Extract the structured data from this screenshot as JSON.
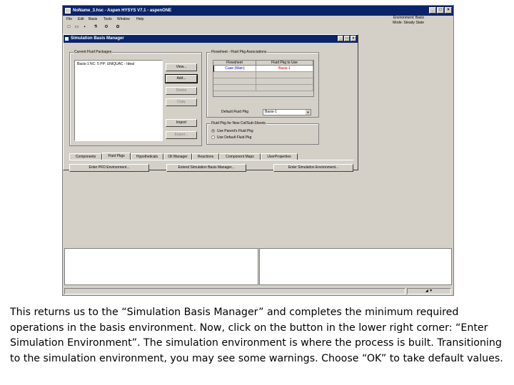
{
  "app": {
    "title": "NoName_3.hsc - Aspen HYSYS V7.1 - aspenONE",
    "window_buttons": [
      "_",
      "□",
      "×"
    ],
    "menu": [
      "File",
      "Edit",
      "Basis",
      "Tools",
      "Window",
      "Help"
    ],
    "menu_right": [
      "Environment: Basis",
      "Mode: Steady State"
    ],
    "toolbar_icons": [
      "new-icon",
      "open-icon",
      "save-icon",
      "fluid-package-icon",
      "components-icon"
    ]
  },
  "sbm": {
    "title": "Simulation Basis Manager",
    "window_buttons": [
      "_",
      "□",
      "×"
    ],
    "current_fluid_packages": {
      "group_label": "Current Fluid Packages",
      "items": [
        "Basis-1    NC: 5    PP: UNIQUAC - Ideal"
      ],
      "buttons": {
        "view": "View...",
        "add": "Add...",
        "delete": "Delete",
        "copy": "Copy",
        "import": "Import",
        "export": "Export..."
      }
    },
    "flowsheet_assoc": {
      "group_label": "Flowsheet - Fluid Pkg Associations",
      "columns": [
        "Flowsheet",
        "Fluid Pkg to Use"
      ],
      "rows": [
        [
          "Case (Main)",
          "Basis-1"
        ],
        [
          "",
          ""
        ],
        [
          "",
          ""
        ],
        [
          "",
          ""
        ]
      ],
      "default_label": "Default Fluid Pkg",
      "default_value": "Basis-1"
    },
    "new_cofreshsheets": {
      "group_label": "Fluid Pkg for New Col/Sub-Sheets",
      "options": [
        {
          "label": "Use Parent's Fluid Pkg",
          "selected": true
        },
        {
          "label": "Use Default Fluid Pkg",
          "selected": false
        }
      ]
    },
    "tabs": [
      "Components",
      "Fluid Pkgs",
      "Hypotheticals",
      "Oil Manager",
      "Reactions",
      "Component Maps",
      "UserProperties"
    ],
    "active_tab": "Fluid Pkgs",
    "bottom_buttons": {
      "enter_pfd": "Enter PFD Environment...",
      "extend_manager": "Extend Simulation Basis Manager...",
      "enter_simulation": "Enter Simulation Environment..."
    }
  },
  "statusbar": {
    "zoom_icon": "zoom-arrows-icon"
  },
  "caption": "This returns us to the “Simulation Basis Manager” and completes the minimum required operations in the basis environment. Now, click on the button in the lower right corner: “Enter Simulation Environment”. The simulation environment is where the process is built. Transitioning to the simulation environment, you may see some warnings. Choose “OK” to take default values."
}
